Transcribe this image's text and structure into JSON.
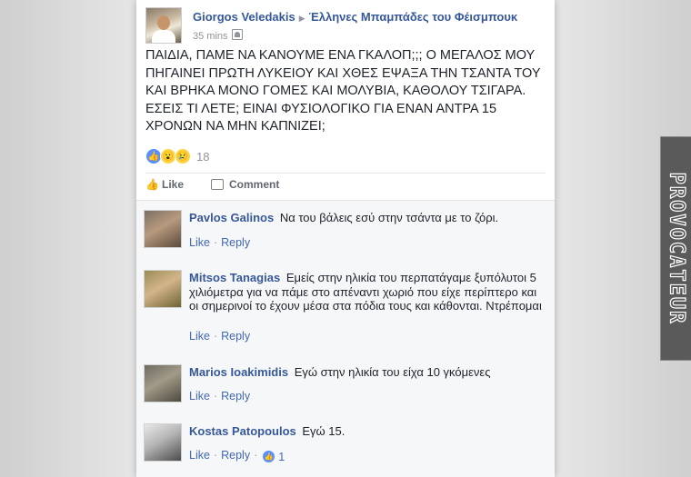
{
  "post": {
    "author": "Giorgos Veledakis",
    "group": "Έλληνες Μπαμπάδες του Φέισμπουκ",
    "time": "35 mins",
    "text": "ΠΑΙΔΙΑ, ΠΑΜΕ ΝΑ ΚΑΝΟΥΜΕ ΕΝΑ ΓΚΑΛΟΠ;;; Ο ΜΕΓΑΛΟΣ ΜΟΥ ΠΗΓΑΙΝΕΙ ΠΡΩΤΗ ΛΥΚΕΙΟΥ ΚΑΙ ΧΘΕΣ ΕΨΑΞΑ ΤΗΝ ΤΣΑΝΤΑ ΤΟΥ ΚΑΙ ΒΡΗΚΑ ΜΟΝΟ ΓΟΜΕΣ ΚΑΙ ΜΟΛΥΒΙΑ, ΚΑΘΟΛΟΥ ΤΣΙΓΑΡΑ. ΕΣΕΙΣ ΤΙ ΛΕΤΕ; ΕΙΝΑΙ ΦΥΣΙΟΛΟΓΙΚΟ ΓΙΑ ΕΝΑΝ ΑΝΤΡΑ 15 ΧΡΟΝΩΝ ΝΑ ΜΗΝ ΚΑΠΝΙΖΕΙ;",
    "reaction_icons": [
      "like-icon",
      "wow-icon",
      "sad-icon"
    ],
    "reaction_count": "18",
    "like_label": "Like",
    "comment_label": "Comment"
  },
  "comments": [
    {
      "name": "Pavlos Galinos",
      "text": "Να του βάλεις εσύ στην τσάντα με το ζόρι.",
      "like": "Like",
      "reply": "Reply"
    },
    {
      "name": "Mitsos Tanagias",
      "text": "Εμείς στην ηλικία του περπατάγαμε ξυπόλυτοι 5 χιλιόμετρα για να πάμε στο απέναντι χωριό που είχε περίπτερο και οι σημερινοί το έχουν μέσα στα πόδια τους και κάθονται. Ντρέπομαι",
      "like": "Like",
      "reply": "Reply"
    },
    {
      "name": "Marios Ioakimidis",
      "text": "Εγώ στην ηλικία του είχα 10 γκόμενες",
      "like": "Like",
      "reply": "Reply"
    },
    {
      "name": "Kostas Patopoulos",
      "text": "Εγώ 15.",
      "like": "Like",
      "reply": "Reply",
      "like_count": "1"
    }
  ],
  "watermark": "PROVOCATEUR",
  "colors": {
    "link": "#365899",
    "action": "#4267b2",
    "muted": "#90949c",
    "comments_bg": "#f6f7f9"
  }
}
